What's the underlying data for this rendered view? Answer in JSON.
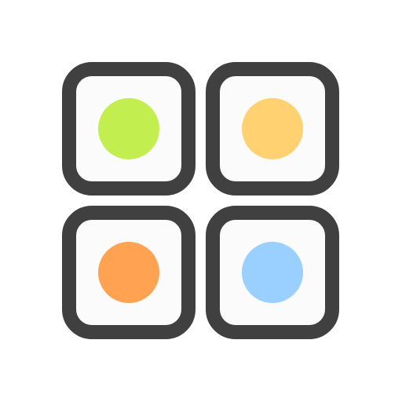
{
  "icon": {
    "name": "four-color-grid-icon",
    "frame_color": "#404040",
    "tile_fill": "#fbfbfb",
    "tiles": [
      {
        "name": "green-dot-tile",
        "dot_color": "#c2ef4f"
      },
      {
        "name": "yellow-dot-tile",
        "dot_color": "#ffd170"
      },
      {
        "name": "orange-dot-tile",
        "dot_color": "#ffa352"
      },
      {
        "name": "blue-dot-tile",
        "dot_color": "#9ad0ff"
      }
    ]
  }
}
